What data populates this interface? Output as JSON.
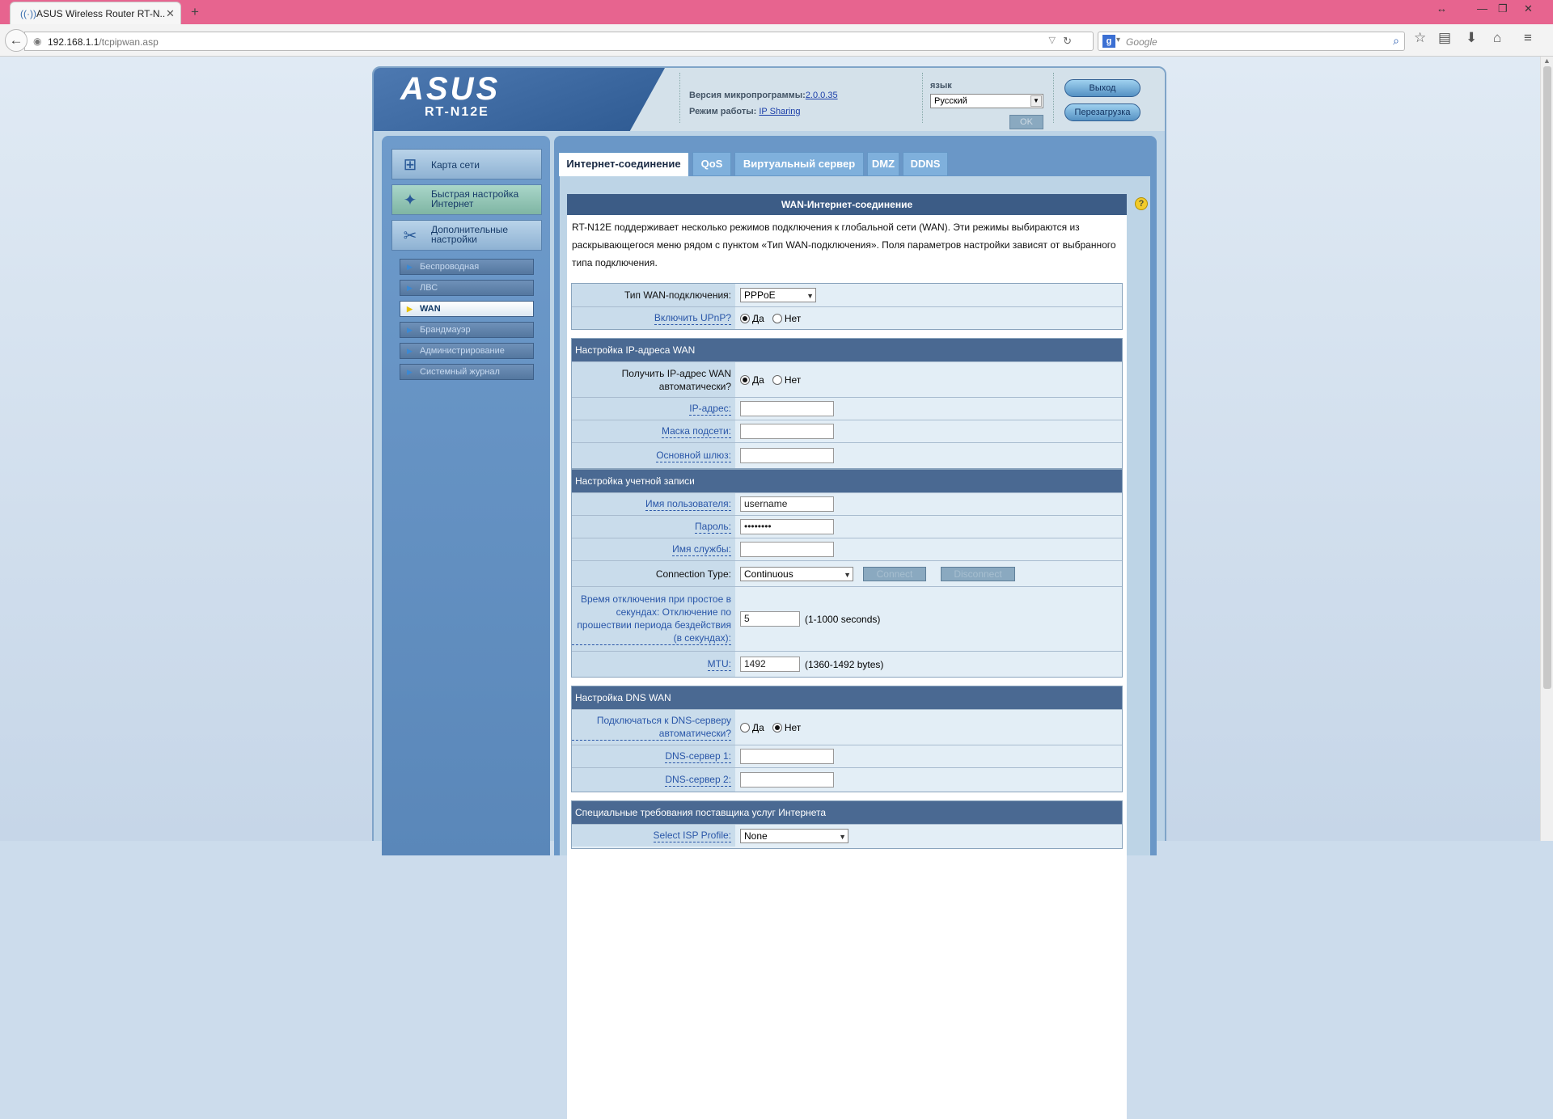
{
  "browser": {
    "tab_title": "ASUS Wireless Router RT-N...",
    "url_host": "192.168.1.1",
    "url_path": "/tcpipwan.asp",
    "search_placeholder": "Google",
    "search_engine_letter": "g"
  },
  "header": {
    "brand": "ASUS",
    "model": "RT-N12E",
    "firmware_label": "Версия микропрограммы:",
    "firmware_version": "2.0.0.35",
    "mode_label": "Режим работы:",
    "mode_value": "IP Sharing",
    "language_label": "язык",
    "language_value": "Русский",
    "ok_label": "OK",
    "logout_label": "Выход",
    "reboot_label": "Перезагрузка"
  },
  "sidebar": {
    "main_items": [
      {
        "label": "Карта сети",
        "icon": "network-map-icon"
      },
      {
        "label": "Быстрая настройка Интернет",
        "icon": "wand-icon"
      },
      {
        "label": "Дополнительные настройки",
        "icon": "tools-icon"
      }
    ],
    "sub_items": [
      {
        "label": "Беспроводная"
      },
      {
        "label": "ЛВС"
      },
      {
        "label": "WAN"
      },
      {
        "label": "Брандмауэр"
      },
      {
        "label": "Администрирование"
      },
      {
        "label": "Системный журнал"
      }
    ]
  },
  "tabs": [
    "Интернет-соединение",
    "QoS",
    "Виртуальный сервер",
    "DMZ",
    "DDNS"
  ],
  "panel": {
    "title": "WAN-Интернет-соединение",
    "intro": "RT-N12E поддерживает несколько режимов подключения к глобальной сети (WAN). Эти режимы выбираются из раскрывающегося меню рядом с пунктом «Тип WAN-подключения». Поля параметров настройки зависят от выбранного типа подключения.",
    "wan_type_label": "Тип WAN-подключения:",
    "wan_type_value": "PPPoE",
    "upnp_label": "Включить UPnP?",
    "yes": "Да",
    "no": "Нет",
    "ip_section": "Настройка IP-адреса WAN",
    "auto_ip_label": "Получить IP-адрес WAN автоматически?",
    "ip_label": "IP-адрес:",
    "mask_label": "Маска подсети:",
    "gateway_label": "Основной шлюз:",
    "account_section": "Настройка учетной записи",
    "user_label": "Имя пользователя:",
    "user_value": "username",
    "password_label": "Пароль:",
    "password_value": "••••••••",
    "service_label": "Имя службы:",
    "conn_type_label": "Connection Type:",
    "conn_type_value": "Continuous",
    "connect_label": "Connect",
    "disconnect_label": "Disconnect",
    "idle_label": "Время отключения при простое в секундах: Отключение по прошествии периода бездействия (в секундах):",
    "idle_value": "5",
    "idle_hint": "(1-1000 seconds)",
    "mtu_label": "MTU:",
    "mtu_value": "1492",
    "mtu_hint": "(1360-1492 bytes)",
    "dns_section": "Настройка DNS WAN",
    "dns_auto_label": "Подключаться к DNS-серверу автоматически?",
    "dns1_label": "DNS-сервер 1:",
    "dns2_label": "DNS-сервер 2:",
    "isp_section": "Специальные требования поставщика услуг Интернета",
    "isp_profile_label": "Select ISP Profile:",
    "isp_profile_value": "None"
  },
  "colors": {
    "titlebar": "#e7648f",
    "panel_header": "#3c5c86",
    "section_header": "#4a6992"
  }
}
